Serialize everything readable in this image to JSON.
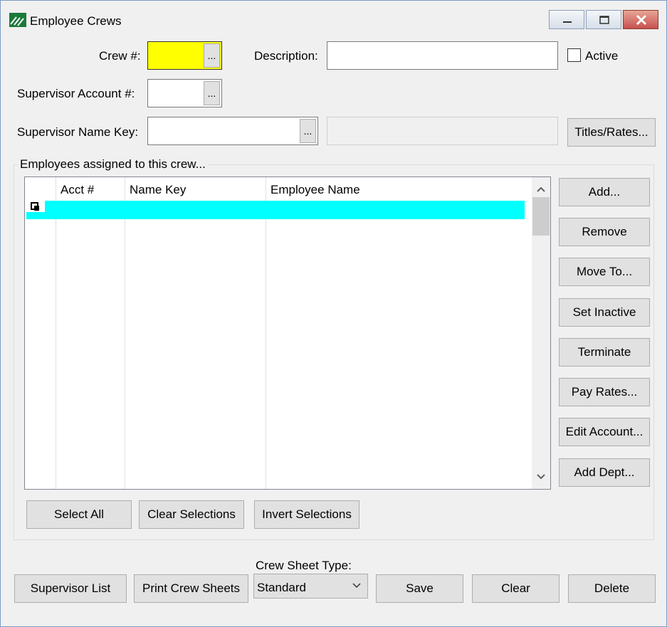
{
  "window": {
    "title": "Employee Crews",
    "min_icon": "minimize-icon",
    "max_icon": "maximize-icon",
    "close_icon": "close-icon"
  },
  "form": {
    "crew_label": "Crew #:",
    "crew_value": "",
    "description_label": "Description:",
    "description_value": "",
    "active_label": "Active",
    "active_checked": false,
    "supervisor_account_label": "Supervisor Account #:",
    "supervisor_account_value": "",
    "supervisor_name_label": "Supervisor Name Key:",
    "supervisor_name_value": "",
    "supervisor_name_display": "",
    "ellipsis": "...",
    "titles_rates_button": "Titles/Rates..."
  },
  "employees": {
    "group_title": "Employees assigned to this crew...",
    "columns": [
      "Acct #",
      "Name Key",
      "Employee Name"
    ],
    "rows": []
  },
  "side_buttons": {
    "add": "Add...",
    "remove": "Remove",
    "move_to": "Move To...",
    "set_inactive": "Set Inactive",
    "terminate": "Terminate",
    "pay_rates": "Pay Rates...",
    "edit_account": "Edit Account...",
    "add_dept": "Add Dept..."
  },
  "selection_buttons": {
    "select_all": "Select All",
    "clear_selections": "Clear Selections",
    "invert_selections": "Invert Selections"
  },
  "bottom": {
    "supervisor_list": "Supervisor List",
    "print_crew_sheets": "Print Crew Sheets",
    "crew_sheet_type_label": "Crew Sheet Type:",
    "crew_sheet_type_value": "Standard",
    "save": "Save",
    "clear": "Clear",
    "delete": "Delete"
  },
  "colors": {
    "accent_yellow": "#ffff00",
    "selection_cyan": "#00ffff",
    "close_red": "#c75050"
  }
}
